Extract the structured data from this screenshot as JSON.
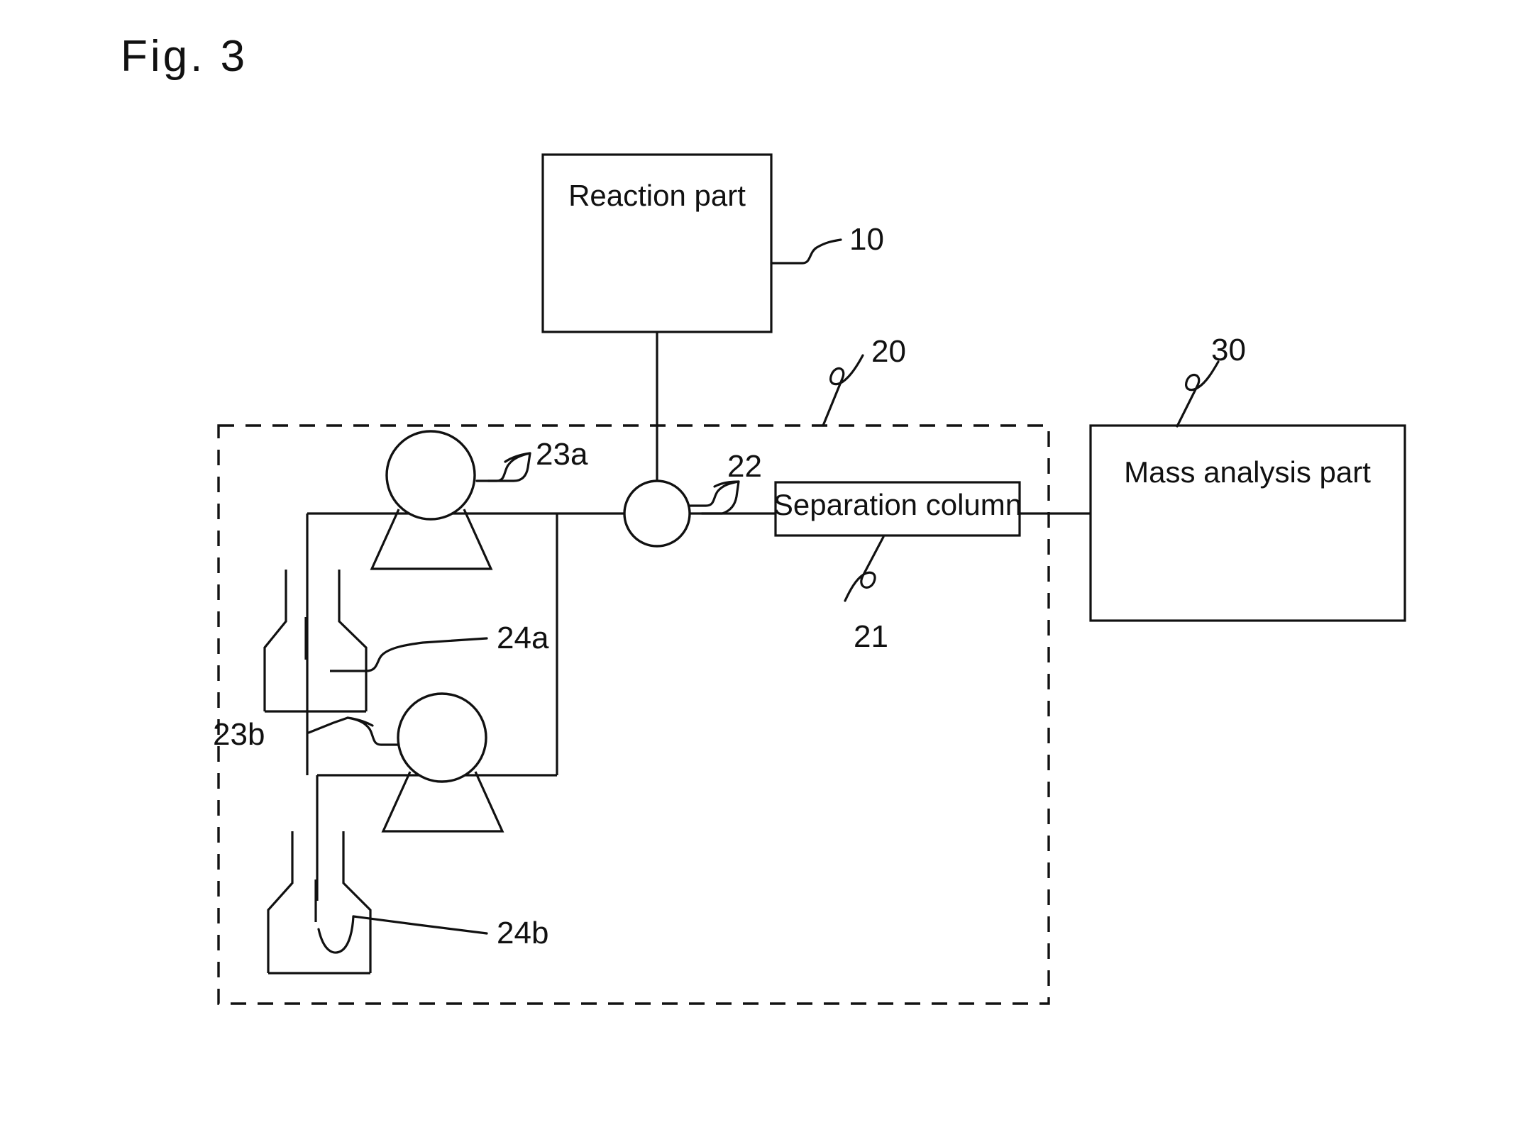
{
  "figure": {
    "label": "Fig. 3"
  },
  "blocks": {
    "reaction_part": {
      "label": "Reaction part",
      "ref": "10"
    },
    "mass_analysis_part": {
      "label": "Mass analysis part",
      "ref": "30"
    },
    "separation_column": {
      "label": "Separation column",
      "ref": "21"
    },
    "enclosure": {
      "ref": "20"
    },
    "valve": {
      "ref": "22"
    },
    "pump_a": {
      "ref": "23a"
    },
    "pump_b": {
      "ref": "23b"
    },
    "container_a": {
      "ref": "24a"
    },
    "container_b": {
      "ref": "24b"
    }
  },
  "colors": {
    "ink": "#111111",
    "paper": "#ffffff"
  }
}
